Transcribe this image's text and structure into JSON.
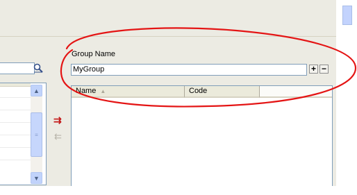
{
  "group": {
    "label": "Group Name",
    "value": "MyGroup",
    "add_glyph": "+",
    "remove_glyph": "−"
  },
  "members_grid": {
    "columns": [
      {
        "label": "Name",
        "sort_glyph": "▲"
      },
      {
        "label": "Code"
      }
    ]
  },
  "left_list": {
    "scroll_up_glyph": "▲",
    "scroll_down_glyph": "▼",
    "thumb_grip": "≡"
  },
  "transfer": {
    "add_glyph": "⇉",
    "remove_glyph": "⇇"
  },
  "icons": {
    "search": "magnifier-icon"
  },
  "colors": {
    "panel_bg": "#ecebe3",
    "field_border": "#7f9db9",
    "annotation_red": "#e41414",
    "add_arrow": "#c31818"
  }
}
